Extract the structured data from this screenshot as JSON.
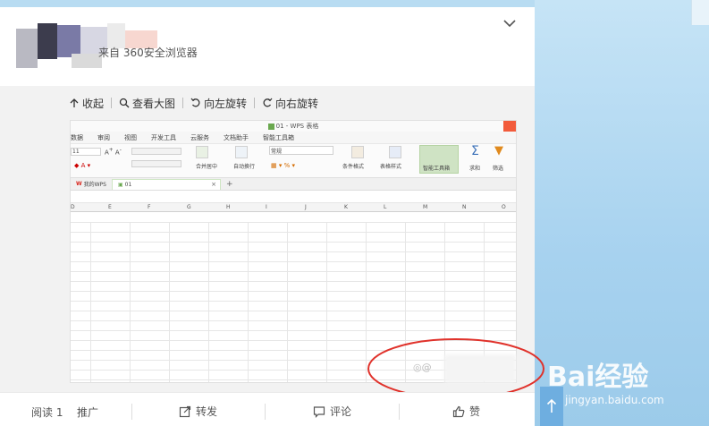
{
  "post": {
    "source_text": "来自 360安全浏览器"
  },
  "image_tools": [
    {
      "label": "收起",
      "icon": "collapse-icon"
    },
    {
      "label": "查看大图",
      "icon": "zoom-icon"
    },
    {
      "label": "向左旋转",
      "icon": "rotate-left-icon"
    },
    {
      "label": "向右旋转",
      "icon": "rotate-right-icon"
    }
  ],
  "screenshot": {
    "window_title": "01 - WPS 表格",
    "menu": [
      "数据",
      "审阅",
      "视图",
      "开发工具",
      "云服务",
      "文档助手",
      "智能工具箱"
    ],
    "ribbon": {
      "font_size": "11",
      "number_format": "常规",
      "merge_center": "合并居中",
      "wrap_text": "自动换行",
      "conditional_format": "条件格式",
      "table_style": "表格样式",
      "smart_toolbox": "智能工具箱",
      "sum": "求和",
      "filter": "筛选"
    },
    "tabs": [
      "我的WPS",
      "01"
    ],
    "columns": [
      "D",
      "E",
      "F",
      "G",
      "H",
      "I",
      "J",
      "K",
      "L",
      "M",
      "N",
      "O"
    ]
  },
  "footer": {
    "read_label": "阅读 1",
    "promote_label": "推广",
    "repost_label": "转发",
    "comment_label": "评论",
    "like_label": "赞"
  },
  "watermark": {
    "brand": "Bai经验",
    "url": "jingyan.baidu.com"
  },
  "colors": {
    "annotation": "#e0322b",
    "background": "#a9d3ee",
    "wps_accent": "#f25b3b"
  }
}
